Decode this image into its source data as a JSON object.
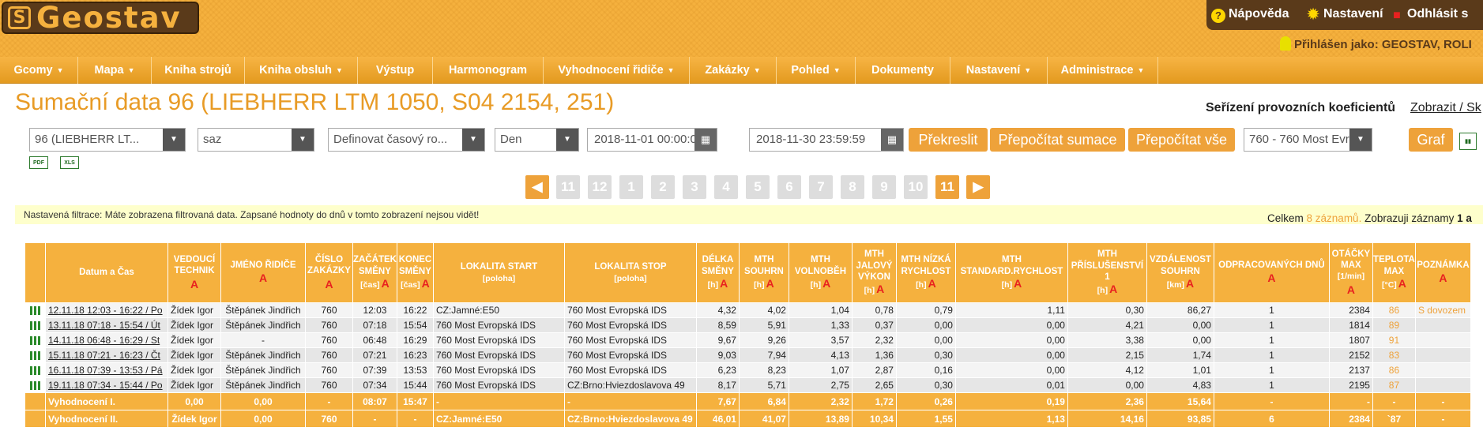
{
  "header": {
    "logo_mark": "S",
    "logo_text": "Geostav",
    "help": "Nápověda",
    "settings": "Nastavení",
    "logout": "Odhlásit s",
    "logged_as": "Přihlášen jako: GEOSTAV, ROLI"
  },
  "menu": [
    {
      "label": "Gcomy",
      "dropdown": true
    },
    {
      "label": "Mapa",
      "dropdown": true
    },
    {
      "label": "Kniha strojů",
      "dropdown": false
    },
    {
      "label": "Kniha obsluh",
      "dropdown": true
    },
    {
      "label": "Výstup",
      "dropdown": false
    },
    {
      "label": "Harmonogram",
      "dropdown": false
    },
    {
      "label": "Vyhodnocení řidiče",
      "dropdown": true
    },
    {
      "label": "Zakázky",
      "dropdown": true
    },
    {
      "label": "Pohled",
      "dropdown": true
    },
    {
      "label": "Dokumenty",
      "dropdown": false
    },
    {
      "label": "Nastavení",
      "dropdown": true
    },
    {
      "label": "Administrace",
      "dropdown": true
    }
  ],
  "page": {
    "title": "Sumační data 96 (LIEBHERR LTM 1050, S04 2154, 251)",
    "koef_label": "Seřízení provozních koeficientů",
    "koef_link": "Zobrazit / Sk"
  },
  "filters": {
    "machine": "96    (LIEBHERR LT...",
    "driver": "saz",
    "period": "Definovat časový ro...",
    "granularity": "Den",
    "date_from": "2018-11-01 00:00:00",
    "date_to": "2018-11-30 23:59:59",
    "btn_redraw": "Překreslit",
    "btn_recalc_sums": "Přepočítat sumace",
    "btn_recalc_all": "Přepočítat vše",
    "location": "760 - 760 Most Evro...",
    "btn_graph": "Graf",
    "export_pdf": "PDF",
    "export_xls": "XLS"
  },
  "pagination": {
    "prev": "◀",
    "pages": [
      "11",
      "12",
      "1",
      "2",
      "3",
      "4",
      "5",
      "6",
      "7",
      "8",
      "9",
      "10",
      "11"
    ],
    "active_index": 12,
    "next": "▶"
  },
  "filter_notice": "Nastavená filtrace: Máte zobrazena filtrovaná data. Zapsané hodnoty do dnů v tomto zobrazení nejsou vidět!",
  "records": {
    "prefix": "Celkem",
    "count": "8 záznamů.",
    "suffix": "Zobrazuji záznamy",
    "range": "1 a"
  },
  "table": {
    "headers": [
      "Datum a Čas",
      "VEDOUCÍ TECHNIK",
      "JMÉNO ŘIDIČE",
      "ČÍSLO ZAKÁZKY",
      "ZAČÁTEK SMĚNY",
      "KONEC SMĚNY",
      "LOKALITA START",
      "LOKALITA STOP",
      "DÉLKA SMĚNY",
      "MTH SOUHRN",
      "MTH VOLNOBĚH",
      "MTH JALOVÝ VÝKON",
      "MTH NÍZKÁ RYCHLOST",
      "MTH STANDARD.RYCHLOST",
      "MTH PŘÍSLUŠENSTVÍ 1",
      "VZDÁLENOST SOUHRN",
      "ODPRACOVANÝCH DNŮ",
      "OTÁČKY MAX",
      "TEPLOTA MAX",
      "POZNÁMKA"
    ],
    "units": {
      "start_shift": "[čas]",
      "end_shift": "[čas]",
      "loc_start": "[poloha]",
      "loc_stop": "[poloha]",
      "len": "[h]",
      "mth": "[h]",
      "mth_idle": "[h]",
      "mth_jalovy": "[h]",
      "mth_low": "[h]",
      "mth_std": "[h]",
      "mth_acc": "[h]",
      "dist": "[km]",
      "rpm": "[1/min]",
      "temp": "[°C]"
    },
    "alarm": "A",
    "rows": [
      [
        "12.11.18 12:03 - 16:22 / Po",
        "Žídek Igor",
        "Štěpánek Jindřich",
        "760",
        "12:03",
        "16:22",
        "CZ:Jamné:E50",
        "760 Most Evropská IDS",
        "4,32",
        "4,02",
        "1,04",
        "0,78",
        "0,79",
        "1,11",
        "0,30",
        "86,27",
        "1",
        "2384",
        "86",
        "S dovozem"
      ],
      [
        "13.11.18 07:18 - 15:54 / Út",
        "Žídek Igor",
        "Štěpánek Jindřich",
        "760",
        "07:18",
        "15:54",
        "760 Most Evropská IDS",
        "760 Most Evropská IDS",
        "8,59",
        "5,91",
        "1,33",
        "0,37",
        "0,00",
        "0,00",
        "4,21",
        "0,00",
        "1",
        "1814",
        "89",
        ""
      ],
      [
        "14.11.18 06:48 - 16:29 / St",
        "Žídek Igor",
        "-",
        "760",
        "06:48",
        "16:29",
        "760 Most Evropská IDS",
        "760 Most Evropská IDS",
        "9,67",
        "9,26",
        "3,57",
        "2,32",
        "0,00",
        "0,00",
        "3,38",
        "0,00",
        "1",
        "1807",
        "91",
        ""
      ],
      [
        "15.11.18 07:21 - 16:23 / Čt",
        "Žídek Igor",
        "Štěpánek Jindřich",
        "760",
        "07:21",
        "16:23",
        "760 Most Evropská IDS",
        "760 Most Evropská IDS",
        "9,03",
        "7,94",
        "4,13",
        "1,36",
        "0,30",
        "0,00",
        "2,15",
        "1,74",
        "1",
        "2152",
        "83",
        ""
      ],
      [
        "16.11.18 07:39 - 13:53 / Pá",
        "Žídek Igor",
        "Štěpánek Jindřich",
        "760",
        "07:39",
        "13:53",
        "760 Most Evropská IDS",
        "760 Most Evropská IDS",
        "6,23",
        "8,23",
        "1,07",
        "2,87",
        "0,16",
        "0,00",
        "4,12",
        "1,01",
        "1",
        "2137",
        "86",
        ""
      ],
      [
        "19.11.18 07:34 - 15:44 / Po",
        "Žídek Igor",
        "Štěpánek Jindřich",
        "760",
        "07:34",
        "15:44",
        "760 Most Evropská IDS",
        "CZ:Brno:Hviezdoslavova 49",
        "8,17",
        "5,71",
        "2,75",
        "2,65",
        "0,30",
        "0,01",
        "0,00",
        "4,83",
        "1",
        "2195",
        "87",
        ""
      ]
    ],
    "summary": [
      [
        "Vyhodnocení I.",
        "0,00",
        "0,00",
        "-",
        "08:07",
        "15:47",
        "-",
        "-",
        "7,67",
        "6,84",
        "2,32",
        "1,72",
        "0,26",
        "0,19",
        "2,36",
        "15,64",
        "-",
        "-",
        "-",
        "-"
      ],
      [
        "Vyhodnocení II.",
        "Žídek Igor",
        "0,00",
        "760",
        "-",
        "-",
        "CZ:Jamné:E50",
        "CZ:Brno:Hviezdoslavova 49",
        "46,01",
        "41,07",
        "13,89",
        "10,34",
        "1,55",
        "1,13",
        "14,16",
        "93,85",
        "6",
        "2384",
        "`87",
        "-"
      ]
    ]
  },
  "colors": {
    "accent": "#f5b13e",
    "accent_dark": "#eea23a",
    "brown": "#5a3a1a",
    "alarm": "#e8211f",
    "title": "#e89b26"
  }
}
